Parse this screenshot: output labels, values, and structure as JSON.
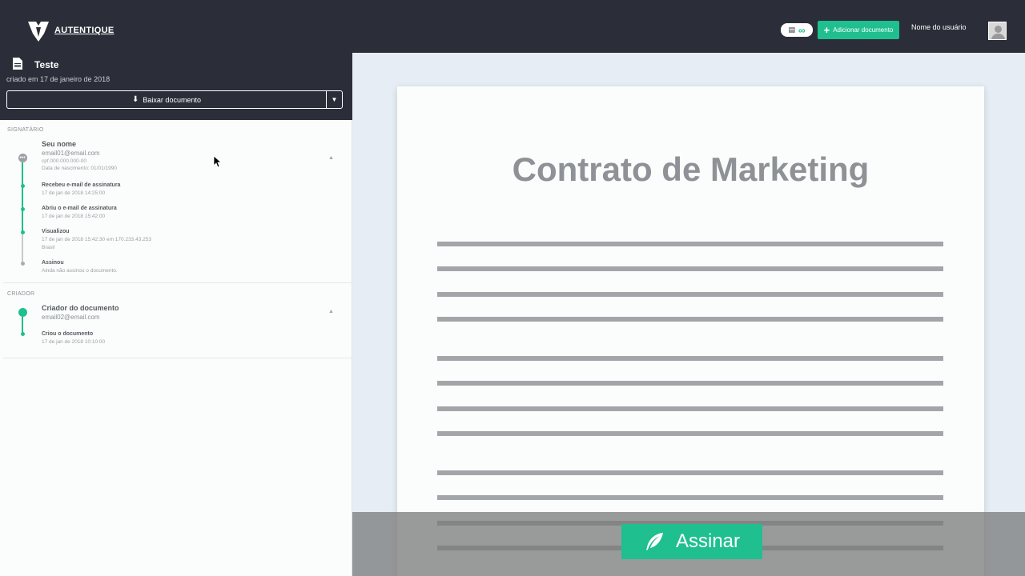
{
  "header": {
    "logo_text": "AUTENTIQUE",
    "credits_icon": "document-icon",
    "credits_value": "∞",
    "add_document_label": "Adicionar documento",
    "username": "Nome do usuário"
  },
  "document": {
    "title": "Teste",
    "created": "criado em 17 de janeiro de 2018",
    "download_label": "Baixar documento"
  },
  "signatory": {
    "section_label": "SIGNATÁRIO",
    "name": "Seu nome",
    "email": "email01@email.com",
    "cpf": "cpf.000.000.000-00",
    "birth": "Data de nascimento: 01/01/1990",
    "events": [
      {
        "title": "Recebeu e-mail de assinatura",
        "sub": "17 de jan de 2018 14:25:00"
      },
      {
        "title": "Abriu o e-mail de assinatura",
        "sub": "17 de jan de 2018 15:42:00"
      },
      {
        "title": "Visualizou",
        "sub": "17 de jan de 2018 15:42:30 em 170.233.43.253",
        "sub2": "Brasil"
      },
      {
        "title": "Assinou",
        "sub": "Ainda não assinou o documento."
      }
    ]
  },
  "creator": {
    "section_label": "CRIADOR",
    "name": "Criador do documento",
    "email": "email02@email.com",
    "events": [
      {
        "title": "Criou o documento",
        "sub": "17 de jan de 2018 10:10:00"
      }
    ]
  },
  "viewer": {
    "contract_title": "Contrato de Marketing",
    "sign_label": "Assinar"
  },
  "colors": {
    "accent": "#1fbf8f",
    "dark": "#2b2e38"
  }
}
